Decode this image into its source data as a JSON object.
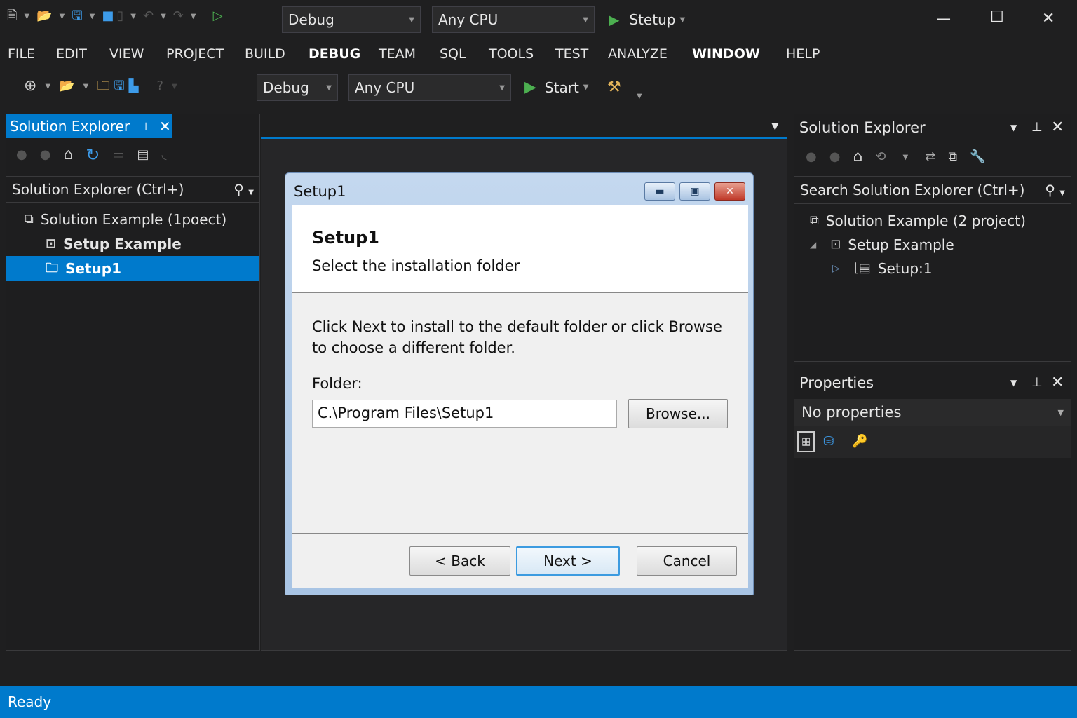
{
  "top_toolbar": {
    "config": "Debug",
    "platform": "Any CPU",
    "run_target": "Stetup"
  },
  "window_controls": {
    "minimize": "—",
    "maximize": "☐",
    "close": "✕"
  },
  "menu": [
    "FILE",
    "EDIT",
    "VIEW",
    "PROJECT",
    "BUILD",
    "DEBUG",
    "TEAM",
    "SQL",
    "TOOLS",
    "TEST",
    "ANALYZE",
    "WINDOW",
    "HELP"
  ],
  "toolbar": {
    "config": "Debug",
    "platform": "Any CPU",
    "start": "Start"
  },
  "left_panel": {
    "tab": "Solution Explorer",
    "search_placeholder": "Solution Explorer (Ctrl+)",
    "tree": [
      "Solution Example (1poect)",
      "Setup Example",
      "Setup1"
    ]
  },
  "right_panel": {
    "title": "Solution Explorer",
    "search_placeholder": "Search Solution Explorer (Ctrl+)",
    "tree": [
      "Solution Example (2 project)",
      "Setup Example",
      "Setup:1"
    ]
  },
  "properties": {
    "title": "Properties",
    "selector": "No properties"
  },
  "dialog": {
    "title": "Setup1",
    "heading": "Setup1",
    "subheading": "Select the installation folder",
    "instructions": "Click Next to install to the default folder or click Browse to choose a different folder.",
    "folder_label": "Folder:",
    "folder_value": "C.\\Program  Files\\Setup1",
    "browse": "Browse...",
    "back": "< Back",
    "next": "Next >",
    "cancel": "Cancel"
  },
  "status": {
    "text": "Ready"
  },
  "colors": {
    "accent": "#007acc",
    "background": "#1f1f20"
  }
}
